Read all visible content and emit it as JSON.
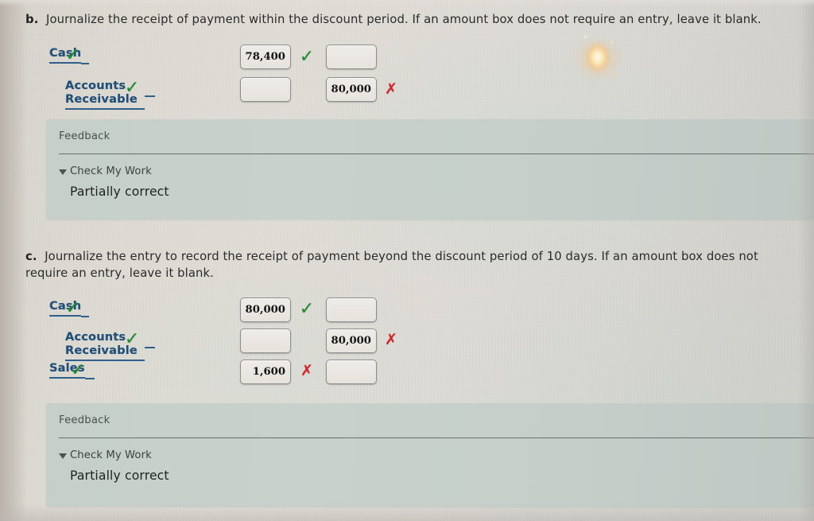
{
  "page": {
    "background_color": "#ddd9d2",
    "glare_color": "#ffbf6e"
  },
  "questions": [
    {
      "id": "b",
      "letter": "b.",
      "prompt": "Journalize the receipt of payment within the discount period. If an amount box does not require an entry, leave it blank.",
      "entries": [
        {
          "account": "Cash",
          "account_mark": "check",
          "debit": "78,400",
          "debit_mark": "check",
          "credit": "",
          "credit_mark": ""
        },
        {
          "account": "Accounts Receivable",
          "account_mark": "check",
          "debit": "",
          "debit_mark": "",
          "credit": "80,000",
          "credit_mark": "x"
        }
      ],
      "feedback": {
        "title": "Feedback",
        "check_my_work": "Check My Work",
        "result": "Partially correct"
      }
    },
    {
      "id": "c",
      "letter": "c.",
      "prompt": "Journalize the entry to record the receipt of payment beyond the discount period of 10 days. If an amount box does not require an entry, leave it blank.",
      "entries": [
        {
          "account": "Cash",
          "account_mark": "check",
          "debit": "80,000",
          "debit_mark": "check",
          "credit": "",
          "credit_mark": ""
        },
        {
          "account": "Accounts Receivable",
          "account_mark": "check",
          "debit": "",
          "debit_mark": "",
          "credit": "80,000",
          "credit_mark": "x"
        },
        {
          "account": "Sales",
          "account_mark": "check",
          "debit": "1,600",
          "debit_mark": "x",
          "credit": "",
          "credit_mark": ""
        }
      ],
      "feedback": {
        "title": "Feedback",
        "check_my_work": "Check My Work",
        "result": "Partially correct"
      }
    }
  ],
  "glyphs": {
    "check": "✓",
    "cross": "✗"
  }
}
